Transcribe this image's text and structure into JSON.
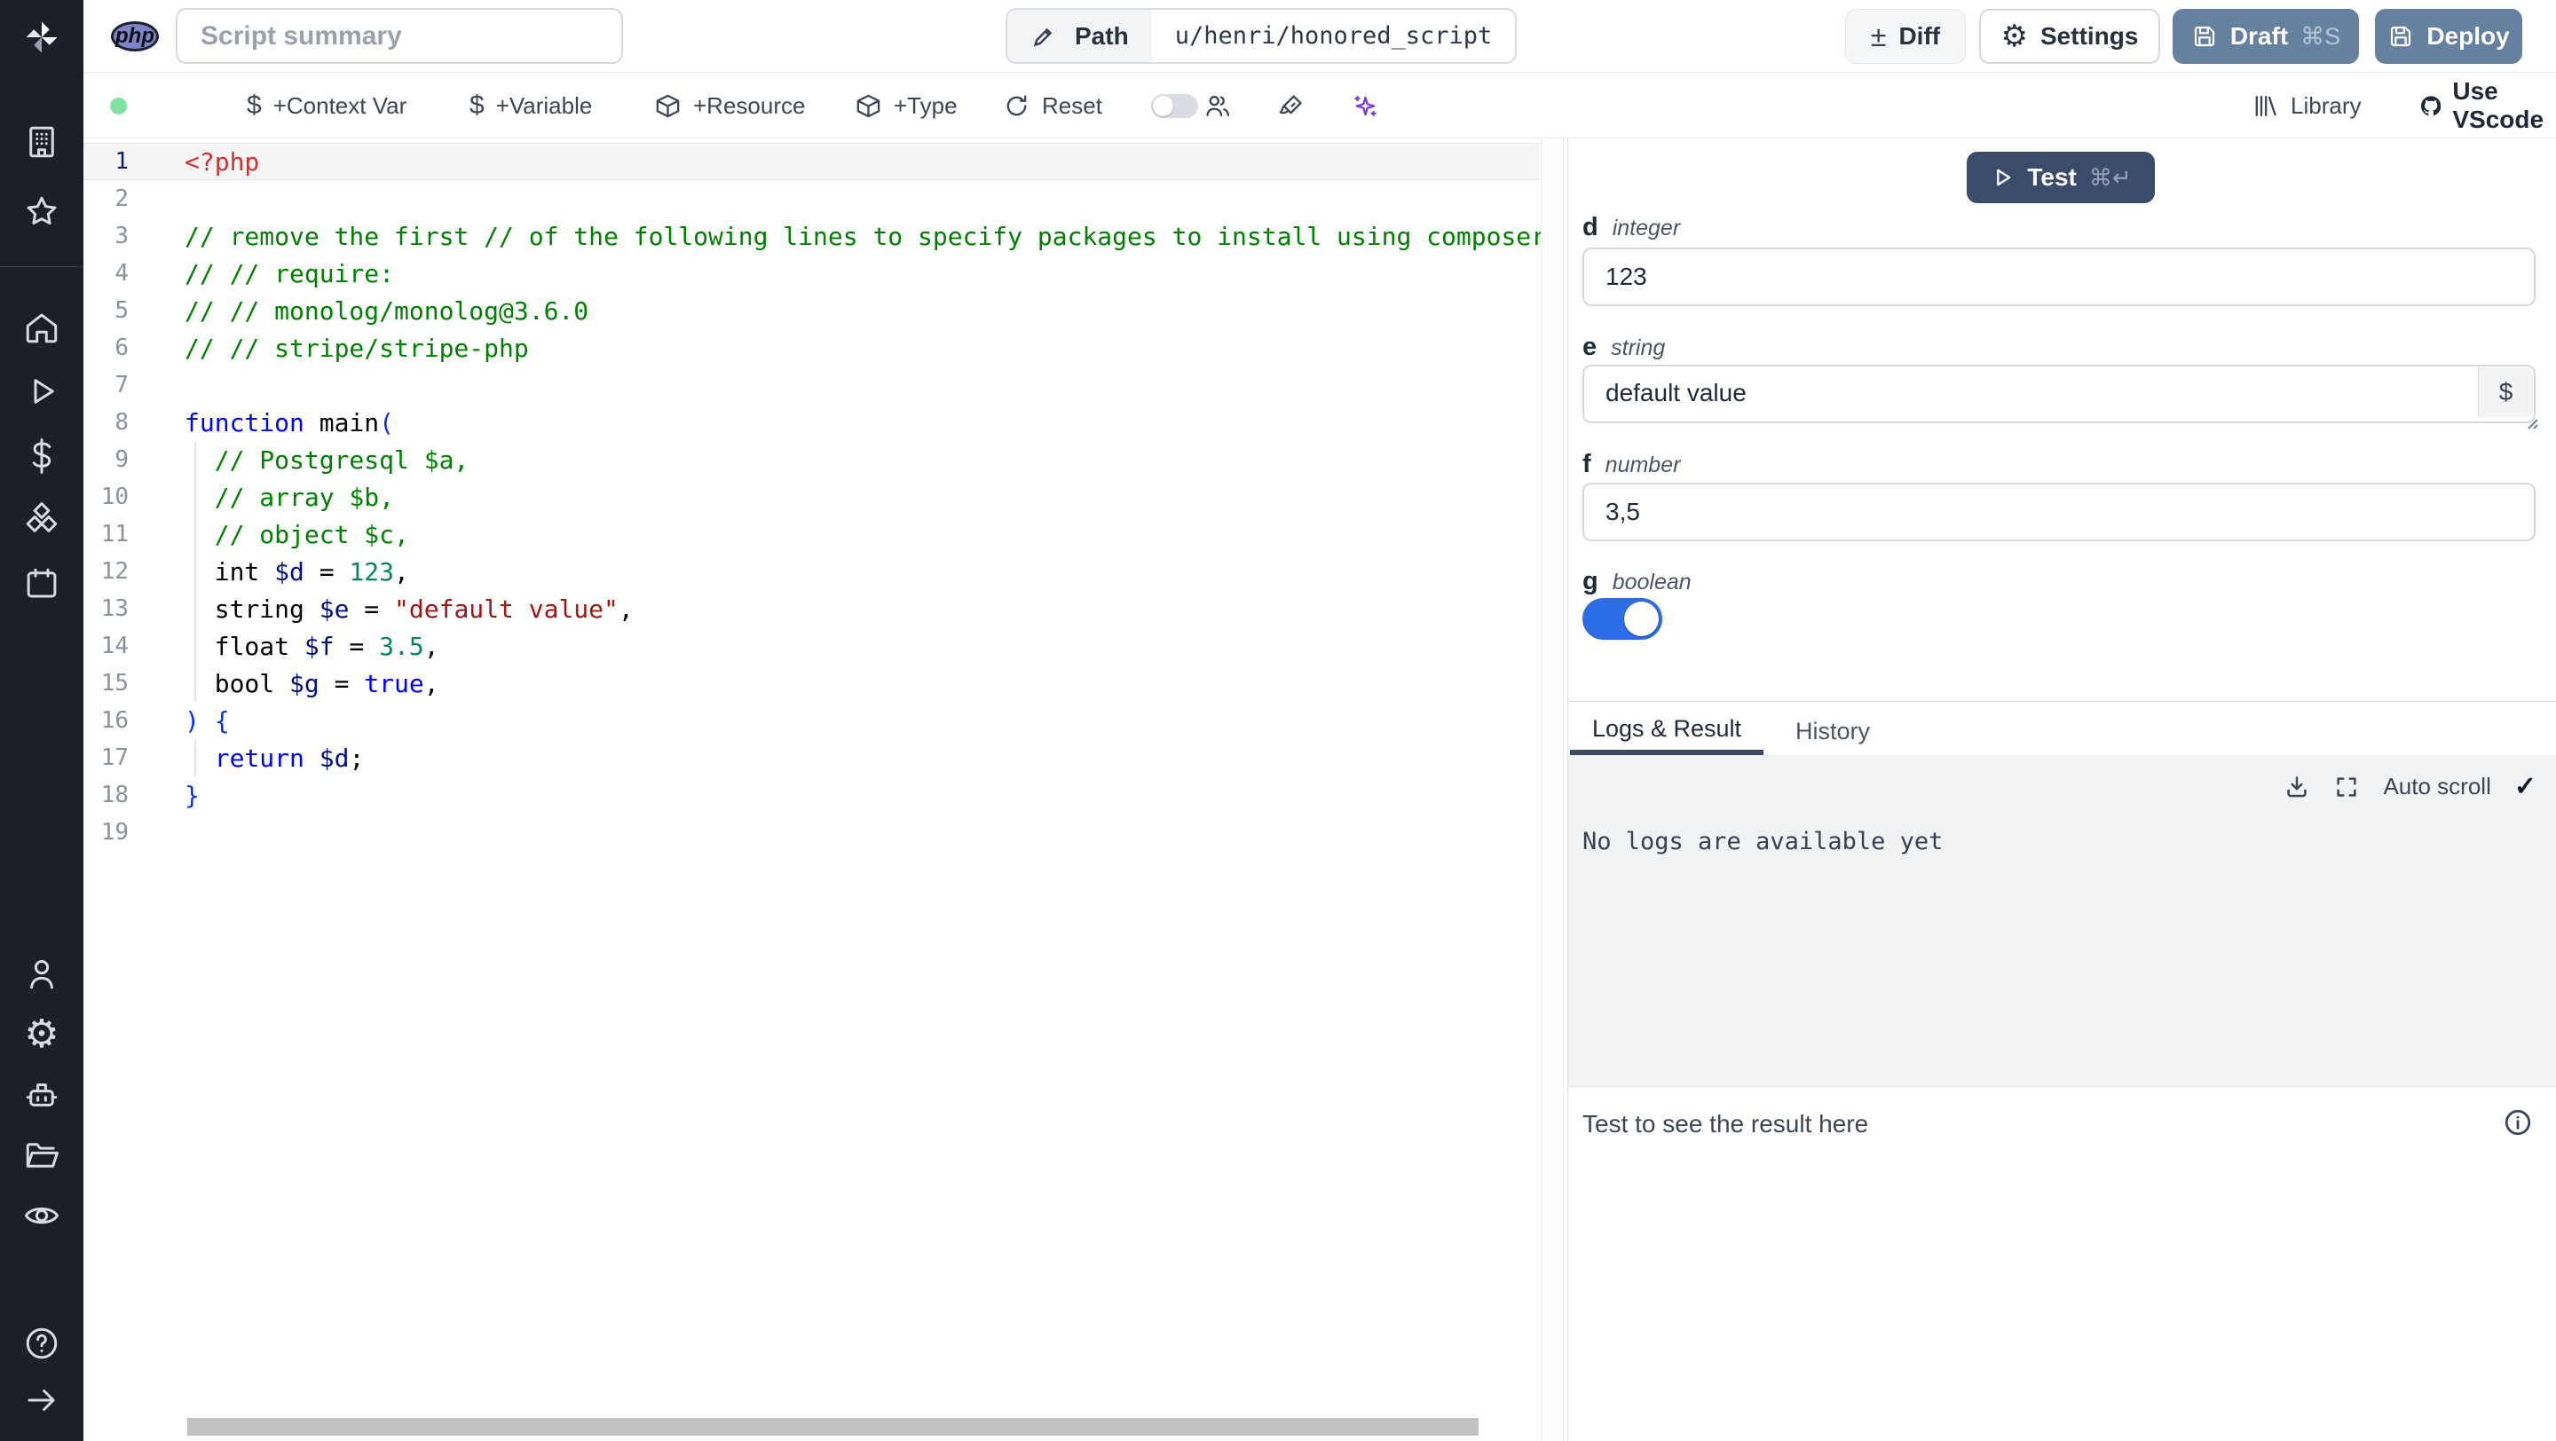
{
  "topbar": {
    "language_badge": "php",
    "summary_placeholder": "Script summary",
    "path_label": "Path",
    "path_value": "u/henri/honored_script",
    "diff_label": "Diff",
    "diff_glyph": "±",
    "settings_label": "Settings",
    "settings_glyph": "⚙",
    "draft_label": "Draft",
    "draft_shortcut": "⌘S",
    "deploy_label": "Deploy",
    "button_color": "#66809f"
  },
  "toolbar": {
    "status_dot_color": "#7fe3a3",
    "dollar_glyph": "$",
    "context_var_label": "+Context Var",
    "variable_label": "+Variable",
    "resource_label": "+Resource",
    "type_label": "+Type",
    "reset_label": "Reset",
    "library_label": "Library",
    "vscode_label": "Use VScode",
    "ai_color": "#7c3aed"
  },
  "editor": {
    "language": "php",
    "active_line": 1,
    "syntax_colors": {
      "tag": "#cc3333",
      "com": "#008000",
      "kw": "#0000ff",
      "var": "#001080",
      "num": "#098658",
      "str": "#a31515",
      "br": "#0431fa",
      "pl": "#000000"
    },
    "lines": [
      {
        "n": 1,
        "seg": [
          {
            "t": "<?php",
            "c": "tag"
          }
        ]
      },
      {
        "n": 2,
        "seg": []
      },
      {
        "n": 3,
        "seg": [
          {
            "t": "// remove the first // of the following lines to specify packages to install using composer",
            "c": "com"
          }
        ]
      },
      {
        "n": 4,
        "seg": [
          {
            "t": "// // require:",
            "c": "com"
          }
        ]
      },
      {
        "n": 5,
        "seg": [
          {
            "t": "// // monolog/monolog@3.6.0",
            "c": "com"
          }
        ]
      },
      {
        "n": 6,
        "seg": [
          {
            "t": "// // stripe/stripe-php",
            "c": "com"
          }
        ]
      },
      {
        "n": 7,
        "seg": []
      },
      {
        "n": 8,
        "seg": [
          {
            "t": "function",
            "c": "kw"
          },
          {
            "t": " main",
            "c": "pl"
          },
          {
            "t": "(",
            "c": "br"
          }
        ]
      },
      {
        "n": 9,
        "seg": [
          {
            "t": "  // Postgresql $a,",
            "c": "com"
          }
        ]
      },
      {
        "n": 10,
        "seg": [
          {
            "t": "  // array $b,",
            "c": "com"
          }
        ]
      },
      {
        "n": 11,
        "seg": [
          {
            "t": "  // object $c,",
            "c": "com"
          }
        ]
      },
      {
        "n": 12,
        "seg": [
          {
            "t": "  int ",
            "c": "pl"
          },
          {
            "t": "$d",
            "c": "var"
          },
          {
            "t": " = ",
            "c": "pl"
          },
          {
            "t": "123",
            "c": "num"
          },
          {
            "t": ",",
            "c": "pl"
          }
        ]
      },
      {
        "n": 13,
        "seg": [
          {
            "t": "  string ",
            "c": "pl"
          },
          {
            "t": "$e",
            "c": "var"
          },
          {
            "t": " = ",
            "c": "pl"
          },
          {
            "t": "\"default value\"",
            "c": "str"
          },
          {
            "t": ",",
            "c": "pl"
          }
        ]
      },
      {
        "n": 14,
        "seg": [
          {
            "t": "  float ",
            "c": "pl"
          },
          {
            "t": "$f",
            "c": "var"
          },
          {
            "t": " = ",
            "c": "pl"
          },
          {
            "t": "3.5",
            "c": "num"
          },
          {
            "t": ",",
            "c": "pl"
          }
        ]
      },
      {
        "n": 15,
        "seg": [
          {
            "t": "  bool ",
            "c": "pl"
          },
          {
            "t": "$g",
            "c": "var"
          },
          {
            "t": " = ",
            "c": "pl"
          },
          {
            "t": "true",
            "c": "kw"
          },
          {
            "t": ",",
            "c": "pl"
          }
        ]
      },
      {
        "n": 16,
        "seg": [
          {
            "t": ") {",
            "c": "br"
          }
        ]
      },
      {
        "n": 17,
        "seg": [
          {
            "t": "  ",
            "c": "pl"
          },
          {
            "t": "return",
            "c": "kw"
          },
          {
            "t": " ",
            "c": "pl"
          },
          {
            "t": "$d",
            "c": "var"
          },
          {
            "t": ";",
            "c": "pl"
          }
        ]
      },
      {
        "n": 18,
        "seg": [
          {
            "t": "}",
            "c": "br"
          }
        ]
      },
      {
        "n": 19,
        "seg": []
      }
    ]
  },
  "right_panel": {
    "test_label": "Test",
    "test_shortcut": "⌘↵",
    "test_button_color": "#3b4b6b",
    "fields": [
      {
        "name": "d",
        "type": "integer",
        "value": "123"
      },
      {
        "name": "e",
        "type": "string",
        "value": "default value",
        "dollar_glyph": "$"
      },
      {
        "name": "f",
        "type": "number",
        "value": "3,5"
      },
      {
        "name": "g",
        "type": "boolean",
        "value": true,
        "toggle_color": "#2c6ce6"
      }
    ],
    "tabs": [
      {
        "label": "Logs & Result",
        "active": true
      },
      {
        "label": "History",
        "active": false
      }
    ],
    "auto_scroll_label": "Auto scroll",
    "auto_scroll_check_glyph": "✓",
    "no_logs_message": "No logs are available yet",
    "result_placeholder": "Test to see the result here"
  },
  "sidebar": {
    "icons": [
      "workspace",
      "favorites",
      "home",
      "runs",
      "variables",
      "resources",
      "schedules",
      "user",
      "settings",
      "workers",
      "folders",
      "audit-logs",
      "help",
      "expand"
    ],
    "help_glyph": "?"
  }
}
